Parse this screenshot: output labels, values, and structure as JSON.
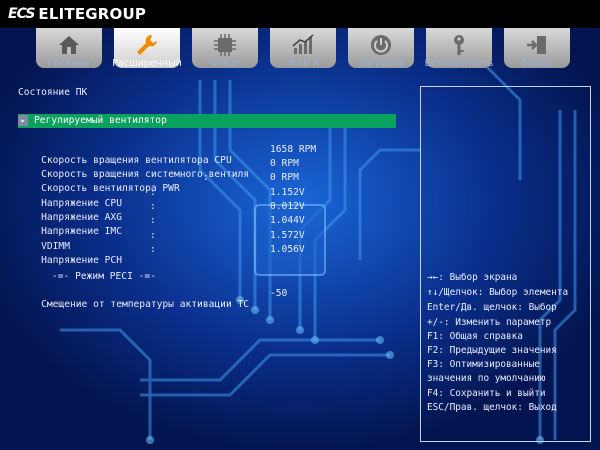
{
  "brand": {
    "mark": "ECS",
    "name": "ELITEGROUP"
  },
  "tabs": [
    {
      "label": "Главные",
      "icon": "home-icon",
      "active": false
    },
    {
      "label": "Расширенный",
      "icon": "wrench-icon",
      "active": true
    },
    {
      "label": "Чипсет",
      "icon": "chip-icon",
      "active": false
    },
    {
      "label": "M.I.B X",
      "icon": "chart-icon",
      "active": false
    },
    {
      "label": "Загрузка",
      "icon": "power-icon",
      "active": false
    },
    {
      "label": "Безопасность",
      "icon": "key-icon",
      "active": false
    },
    {
      "label": "Выход",
      "icon": "exit-icon",
      "active": false
    }
  ],
  "main": {
    "section_title": "Состояние ПК",
    "submenu": {
      "arrow": "▸",
      "label": "Регулируемый вентилятор"
    },
    "rows": [
      {
        "label": "Скорость вращения вентилятора CPU",
        "colon": "",
        "value": "1658 RPM"
      },
      {
        "label": "Скорость вращения системного вентиля",
        "colon": "",
        "value": "0 RPM"
      },
      {
        "label": "Скорость вентилятора PWR",
        "colon": ":",
        "value": "0 RPM"
      },
      {
        "label": "Напряжение CPU",
        "colon": ":",
        "value": "1.152V"
      },
      {
        "label": "Напряжение AXG",
        "colon": ":",
        "value": "0.012V"
      },
      {
        "label": "Напряжение IMC",
        "colon": ":",
        "value": "1.044V"
      },
      {
        "label": "VDIMM",
        "colon": ":",
        "value": "1.572V"
      },
      {
        "label": "Напряжение PCH",
        "colon": ":",
        "value": "1.056V"
      }
    ],
    "peci_title": "-=- Режим PECI -=-",
    "peci_row": {
      "label": "Смещение от температуры активации TC",
      "value": "-50"
    }
  },
  "help": [
    "→←: Выбор экрана",
    "↑↓/Щелчок: Выбор элемента",
    "Enter/Дв. щелчок: Выбор",
    "+/-: Изменить параметр",
    "F1: Общая справка",
    "F2: Предыдущие значения",
    "F3: Оптимизированные",
    "значения по умолчанию",
    "F4: Сохранить и выйти",
    "ESC/Прав. щелчок: Выход"
  ],
  "colors": {
    "accent_green": "#0aa05e",
    "background": "#04185a",
    "circuit": "#2a7fd6"
  }
}
